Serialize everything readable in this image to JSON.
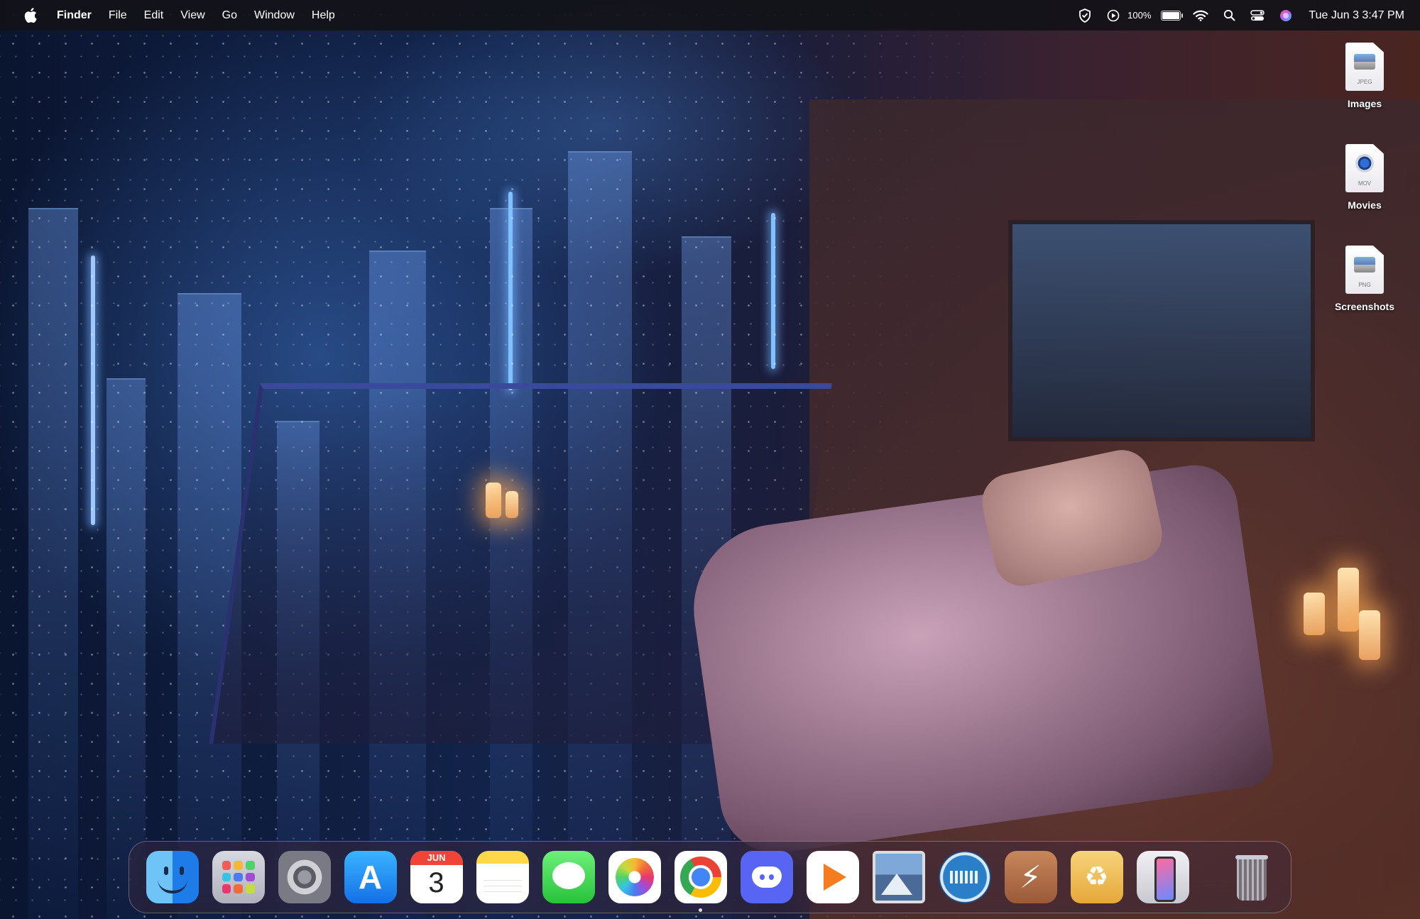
{
  "menubar": {
    "apple_icon": "apple-logo-icon",
    "app_name": "Finder",
    "menus": [
      "File",
      "Edit",
      "View",
      "Go",
      "Window",
      "Help"
    ],
    "status_icons": [
      "shield-icon",
      "play-circle-icon"
    ],
    "battery_text": "100%",
    "battery_level": 1.0,
    "right_icons": [
      "wifi-icon",
      "search-icon",
      "control-center-icon",
      "siri-icon"
    ],
    "clock": "Tue Jun 3  3:47 PM"
  },
  "desktop_icons": [
    {
      "label": "Images",
      "ext": "JPEG"
    },
    {
      "label": "Movies",
      "ext": "MOV"
    },
    {
      "label": "Screenshots",
      "ext": "PNG"
    }
  ],
  "dock": {
    "apps": [
      "Finder",
      "Launchpad",
      "System Settings",
      "App Store",
      "Calendar",
      "Notes",
      "Messages",
      "Photos",
      "Google Chrome",
      "Discord",
      "Infuse",
      "Preview",
      "Keyboard Maestro",
      "Reeder",
      "Cleaner",
      "iPhone Mirroring",
      "Trash"
    ],
    "calendar_month": "JUN",
    "calendar_day": "3"
  }
}
